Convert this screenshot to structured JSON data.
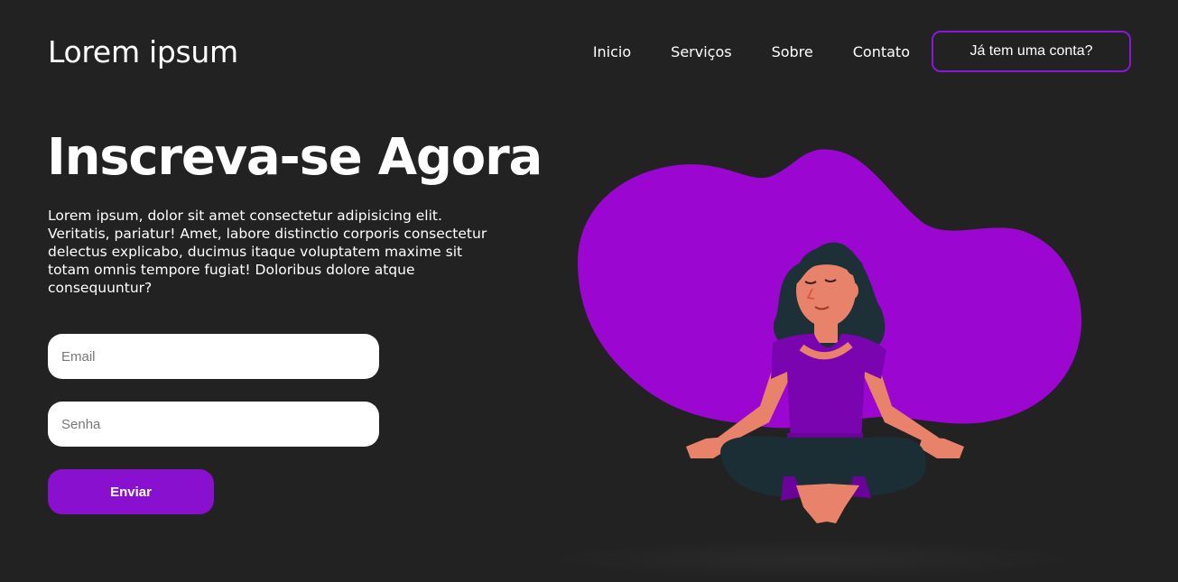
{
  "header": {
    "logo": "Lorem ipsum",
    "nav": [
      "Inicio",
      "Serviços",
      "Sobre",
      "Contato"
    ],
    "account_button": "Já tem uma conta?"
  },
  "hero": {
    "title": "Inscreva-se Agora",
    "description": "Lorem ipsum, dolor sit amet consectetur adipisicing elit. Veritatis, pariatur! Amet, labore distinctio corporis consectetur delectus explicabo, ducimus itaque voluptatem maxime sit totam omnis tempore fugiat! Doloribus dolore atque consequuntur?"
  },
  "form": {
    "email_placeholder": "Email",
    "password_placeholder": "Senha",
    "submit_label": "Enviar"
  },
  "colors": {
    "background": "#222222",
    "accent": "#8a10cf",
    "blob": "#9b07d1"
  },
  "illustration": {
    "icon": "meditating-woman-illustration"
  }
}
